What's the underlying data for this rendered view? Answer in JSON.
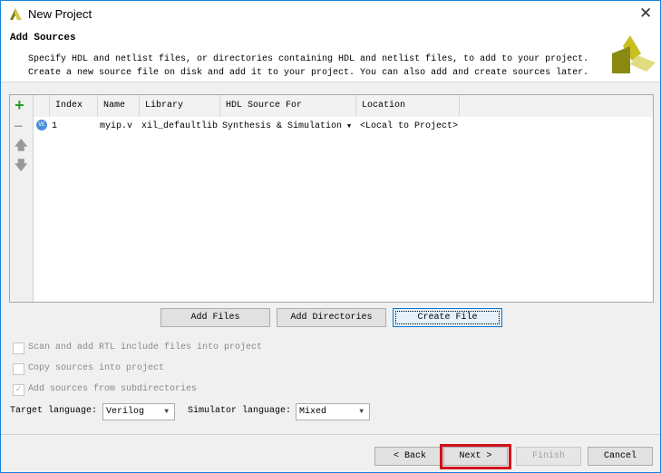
{
  "window": {
    "title": "New Project",
    "close_icon": "close-icon"
  },
  "header": {
    "title": "Add Sources",
    "desc_line1": "Specify HDL and netlist files, or directories containing HDL and netlist files, to add to your project.",
    "desc_line2": "Create a new source file on disk and add it to your project. You can also add and create sources later."
  },
  "table": {
    "columns": [
      "Index",
      "Name",
      "Library",
      "HDL Source For",
      "Location"
    ],
    "rows": [
      {
        "index": "1",
        "name": "myip.v",
        "library": "xil_defaultlib",
        "hdl_source_for": "Synthesis & Simulation",
        "location": "<Local to Project>"
      }
    ]
  },
  "buttons": {
    "add_files": "Add Files",
    "add_directories": "Add Directories",
    "create_file": "Create File",
    "back": "< Back",
    "next": "Next >",
    "finish": "Finish",
    "cancel": "Cancel"
  },
  "options": [
    {
      "label": "Scan and add RTL include files into project",
      "checked": false
    },
    {
      "label": "Copy sources into project",
      "checked": false
    },
    {
      "label": "Add sources from subdirectories",
      "checked": true
    }
  ],
  "target_language": {
    "label": "Target language:",
    "value": "Verilog"
  },
  "simulator_language": {
    "label": "Simulator language:",
    "value": "Mixed"
  },
  "colors": {
    "highlight": "#d0111b",
    "accent": "#1883d7"
  }
}
